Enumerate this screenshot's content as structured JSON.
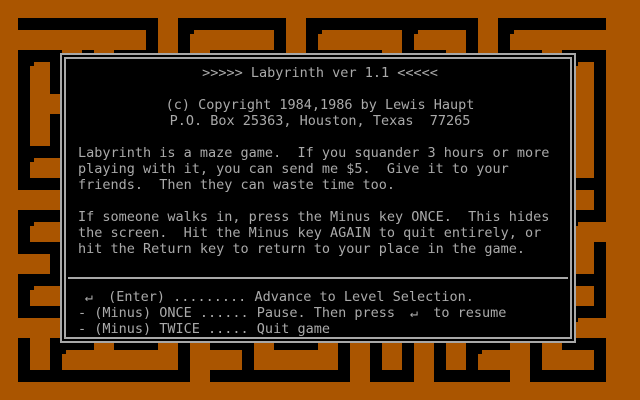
{
  "title": ">>>>> Labyrinth ver 1.1 <<<<<",
  "copyright": "(c) Copyright 1984,1986 by Lewis Haupt",
  "address": "P.O. Box 25363, Houston, Texas  77265",
  "paragraph1": [
    "Labyrinth is a maze game.  If you squander 3 hours or more",
    "playing with it, you can send me $5.  Give it to your",
    "friends.  Then they can waste time too."
  ],
  "paragraph2": [
    "If someone walks in, press the Minus key ONCE.  This hides",
    "the screen.  Hit the Minus key AGAIN to quit entirely, or",
    "hit the Return key to return to your place in the game."
  ],
  "keys": {
    "enter": {
      "key": " (Enter) .........",
      "action": " Advance to Level Selection."
    },
    "minus_once": {
      "text": "- (Minus) ONCE ...... Pause. Then press",
      "suffix": "to resume"
    },
    "minus_twice": {
      "text": "- (Minus) TWICE ..... Quit game"
    }
  },
  "icons": {
    "return_key": "return-arrow-icon"
  },
  "colors": {
    "maze_wall": "#aa5500",
    "maze_path": "#000000",
    "text": "#aaaaaa",
    "border": "#a8a8a8"
  }
}
